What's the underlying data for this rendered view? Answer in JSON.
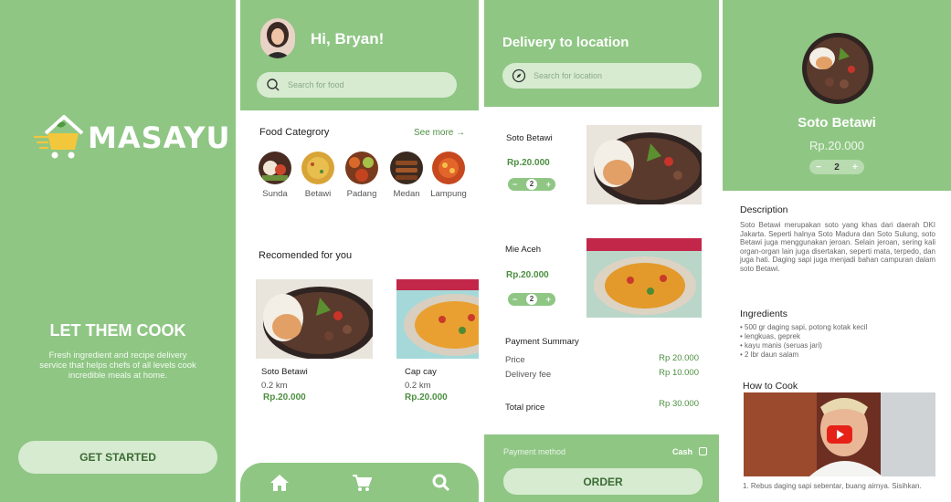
{
  "splash": {
    "brand": "MASAYU",
    "tagline": "LET THEM COOK",
    "description": "Fresh ingredient and recipe delivery service that helps chefs of all levels cook incredible meals at home.",
    "cta": "GET STARTED"
  },
  "home": {
    "greeting": "Hi, Bryan!",
    "search_placeholder": "Search for food",
    "category_title": "Food Categrory",
    "see_more": "See more →",
    "categories": [
      {
        "label": "Sunda"
      },
      {
        "label": "Betawi"
      },
      {
        "label": "Padang"
      },
      {
        "label": "Medan"
      },
      {
        "label": "Lampung"
      }
    ],
    "recommended_title": "Recomended for you",
    "recommended": [
      {
        "name": "Soto Betawi",
        "distance": "0.2 km",
        "price": "Rp.20.000"
      },
      {
        "name": "Cap cay",
        "distance": "0.2 km",
        "price": "Rp.20.000"
      }
    ],
    "nav": [
      "home-icon",
      "cart-icon",
      "search-icon"
    ]
  },
  "cart": {
    "title": "Delivery to location",
    "search_placeholder": "Search for location",
    "items": [
      {
        "name": "Soto Betawi",
        "price": "Rp.20.000",
        "qty": "2"
      },
      {
        "name": "Mie Aceh",
        "price": "Rp.20.000",
        "qty": "2"
      }
    ],
    "summary_title": "Payment Summary",
    "price_label": "Price",
    "price_value": "Rp 20.000",
    "delivery_label": "Delivery fee",
    "delivery_value": "Rp 10.000",
    "total_label": "Total price",
    "total_value": "Rp 30.000",
    "payment_method_label": "Payment method",
    "payment_method_value": "Cash",
    "order_button": "ORDER"
  },
  "detail": {
    "name": "Soto Betawi",
    "price": "Rp.20.000",
    "qty": "2",
    "description_title": "Description",
    "description": "Soto Betawi merupakan soto yang khas dari daerah DKI Jakarta. Seperti halnya Soto Madura dan Soto Sulung, soto Betawi juga menggunakan jeroan. Selain jeroan, sering kali organ-organ lain juga disertakan, seperti mata, terpedo, dan juga hati. Daging sapi juga menjadi bahan campuran dalam soto Betawi.",
    "ingredients_title": "Ingredients",
    "ingredients": [
      "500 gr daging sapi, potong kotak kecil",
      "lengkuas, geprek",
      "kayu manis (seruas jari)",
      "2 lbr daun salam"
    ],
    "how_to_title": "How to Cook",
    "step1": "1. Rebus daging sapi sebentar, buang airnya. Sisihkan."
  },
  "colors": {
    "primary": "#8fc684",
    "light": "#d7ebd1",
    "accent_text": "#4c8f40"
  }
}
